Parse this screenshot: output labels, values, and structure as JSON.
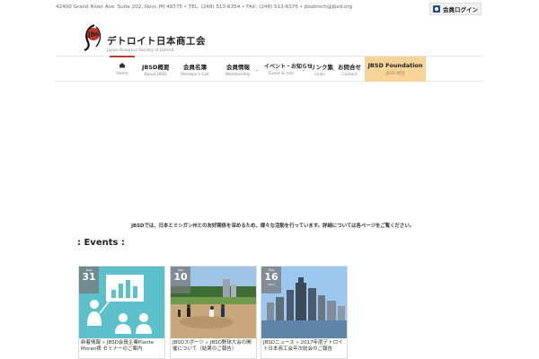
{
  "header": {
    "contact": "42400 Grand River Ave. Suite 202, Novi, MI 48375 • TEL: (248) 513-6354 • FAX: (248) 513-6376 • jbsdmich@jbsd.org",
    "login_label": "会員ログイン"
  },
  "logo": {
    "mark": "JBS",
    "title_jp": "デトロイト日本商工会",
    "subtitle_en": "Japan Business Society of Detroit"
  },
  "nav": {
    "items": [
      {
        "jp": "",
        "en": "Home"
      },
      {
        "jp": "JBSD概要",
        "en": "About JBSD"
      },
      {
        "jp": "会員名簿",
        "en": "Member's List"
      },
      {
        "jp": "会員情報",
        "en": "Membership"
      },
      {
        "jp": "イベント・お知らせ",
        "en": "Event & Info"
      },
      {
        "jp": "リンク集",
        "en": "Links"
      },
      {
        "jp": "お問合せ",
        "en": "Contact"
      },
      {
        "jp": "JBSD Foundation",
        "en": "JBSD 財団"
      }
    ]
  },
  "notice": "JBSDでは、日本とミシガン州との友好関係を深めるため、様々な活動を行っています。詳細については各ページをご覧ください。",
  "events": {
    "heading": ": Events :",
    "cards": [
      {
        "month": "Aug",
        "day": "31",
        "year": "",
        "title": "新着情報 » JBSD会員企業Plante Moran様 セミナーのご案内"
      },
      {
        "month": "Sep",
        "day": "10",
        "year": "",
        "title": "JBSDスポーツ » JBSD野球大会の開催について（結果のご報告）"
      },
      {
        "month": "Sep",
        "day": "16",
        "year": "2017",
        "title": "JBSDニュース » 2017年度デトロイト日本商工会年次総会のご報告"
      }
    ]
  },
  "colors": {
    "accent_red": "#c0392b",
    "foundation_bg": "#f7d49a",
    "login_icon": "#1e4d8c"
  }
}
